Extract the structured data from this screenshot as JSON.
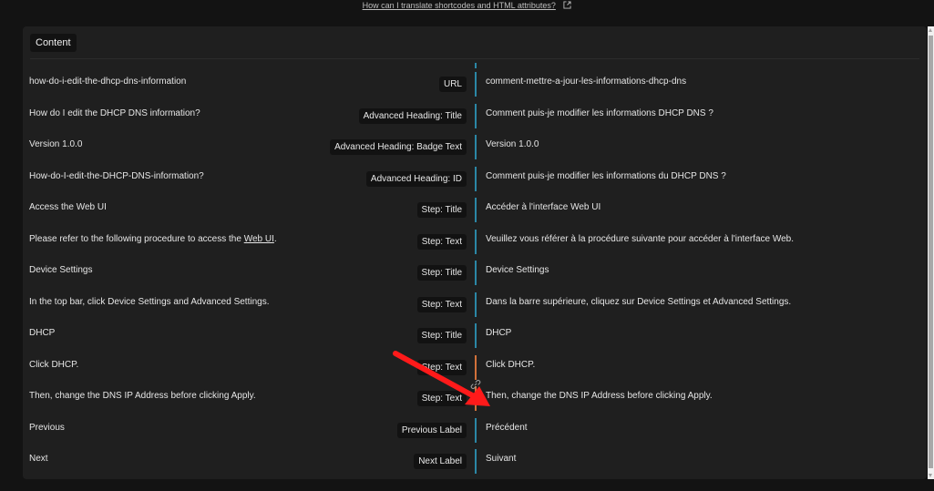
{
  "help": {
    "link_text": "How can I translate shortcodes and HTML attributes?",
    "icon": "external-link-icon"
  },
  "panel": {
    "tab_label": "Content"
  },
  "colors": {
    "background": "#131313",
    "panel": "#1f1f1f",
    "badge": "#121212",
    "bar_default": "#2b87a6",
    "bar_linked": "#d2713a",
    "annotation_arrow": "#ff1a1a"
  },
  "rows": [
    {
      "source": "how-do-i-edit-the-dhcp-dns-information",
      "label": "URL",
      "target": "comment-mettre-a-jour-les-informations-dhcp-dns",
      "linked": false
    },
    {
      "source": "How do I edit the DHCP DNS information?",
      "label": "Advanced Heading: Title",
      "target": "Comment puis-je modifier les informations DHCP DNS ?",
      "linked": false
    },
    {
      "source": "Version 1.0.0",
      "label": "Advanced Heading: Badge Text",
      "target": "Version 1.0.0",
      "linked": false
    },
    {
      "source": "How-do-I-edit-the-DHCP-DNS-information?",
      "label": "Advanced Heading: ID",
      "target": "Comment puis-je modifier les informations du DHCP DNS ?",
      "linked": false
    },
    {
      "source": "Access the Web UI",
      "label": "Step: Title",
      "target": "Accéder à l'interface Web UI",
      "linked": false
    },
    {
      "source_prefix": "Please refer to the following procedure to access the ",
      "source_link": "Web UI",
      "source_suffix": ".",
      "label": "Step: Text",
      "target": "Veuillez vous référer à la procédure suivante pour accéder à l'interface Web.",
      "linked": false
    },
    {
      "source": "Device Settings",
      "label": "Step: Title",
      "target": "Device Settings",
      "linked": false
    },
    {
      "source": "In the top bar, click Device Settings and Advanced Settings.",
      "label": "Step: Text",
      "target": "Dans la barre supérieure, cliquez sur Device Settings et Advanced Settings.",
      "linked": false
    },
    {
      "source": "DHCP",
      "label": "Step: Title",
      "target": "DHCP",
      "linked": false
    },
    {
      "source": "Click DHCP.",
      "label": "Step: Text",
      "target": "Click DHCP.",
      "linked": true
    },
    {
      "source": "Then, change the DNS IP Address before clicking Apply.",
      "label": "Step: Text",
      "target": "Then, change the DNS IP Address before clicking Apply.",
      "linked": true
    },
    {
      "source": "Previous",
      "label": "Previous Label",
      "target": "Précédent",
      "linked": false
    },
    {
      "source": "Next",
      "label": "Next Label",
      "target": "Suivant",
      "linked": false
    }
  ],
  "link_toggle": {
    "icon": "link-icon",
    "between_rows": [
      10,
      11
    ]
  }
}
